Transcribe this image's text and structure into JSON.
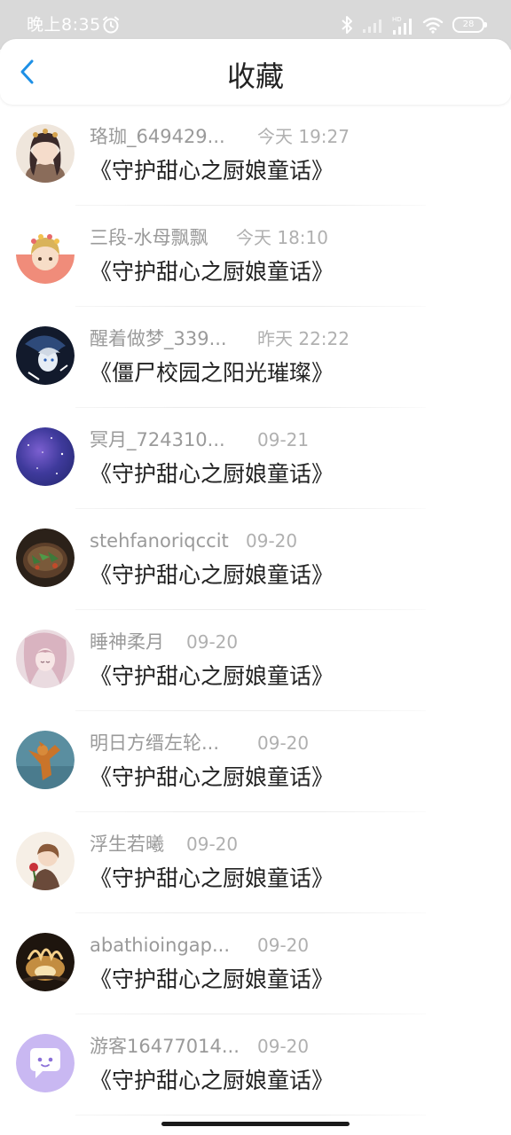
{
  "status_bar": {
    "time": "晚上8:35",
    "battery": "28",
    "icons": [
      "alarm-icon",
      "bluetooth-icon",
      "signal-icon",
      "signal-hd-icon",
      "wifi-icon",
      "battery-icon"
    ]
  },
  "header": {
    "title": "收藏",
    "back_icon": "chevron-left-icon",
    "accent": "#1e90e6"
  },
  "favorites": [
    {
      "name": "珞珈_649429...",
      "time": "今天 19:27",
      "book": "《守护甜心之厨娘童话》",
      "avatar_color": "#d8c7b5"
    },
    {
      "name": "三段-水母飘飘",
      "time": "今天 18:10",
      "book": "《守护甜心之厨娘童话》",
      "avatar_color": "#f0a08a"
    },
    {
      "name": "醒着做梦_339...",
      "time": "昨天 22:22",
      "book": "《僵尸校园之阳光璀璨》",
      "avatar_color": "#1f2a45"
    },
    {
      "name": "冥月_724310...",
      "time": "09-21",
      "book": "《守护甜心之厨娘童话》",
      "avatar_color": "#4a3f9a"
    },
    {
      "name": "stehfanoriqccit",
      "time": "09-20",
      "book": "《守护甜心之厨娘童话》",
      "avatar_color": "#5a4632"
    },
    {
      "name": "睡神柔月",
      "time": "09-20",
      "book": "《守护甜心之厨娘童话》",
      "avatar_color": "#d9b9c4"
    },
    {
      "name": "明日方缙左轮...",
      "time": "09-20",
      "book": "《守护甜心之厨娘童话》",
      "avatar_color": "#4a7b8f"
    },
    {
      "name": "浮生若曦",
      "time": "09-20",
      "book": "《守护甜心之厨娘童话》",
      "avatar_color": "#c9b19a"
    },
    {
      "name": "abathioingap...",
      "time": "09-20",
      "book": "《守护甜心之厨娘童话》",
      "avatar_color": "#3a2a1e"
    },
    {
      "name": "游客16477014...",
      "time": "09-20",
      "book": "《守护甜心之厨娘童话》",
      "avatar_color": "#c8b8f0"
    }
  ]
}
